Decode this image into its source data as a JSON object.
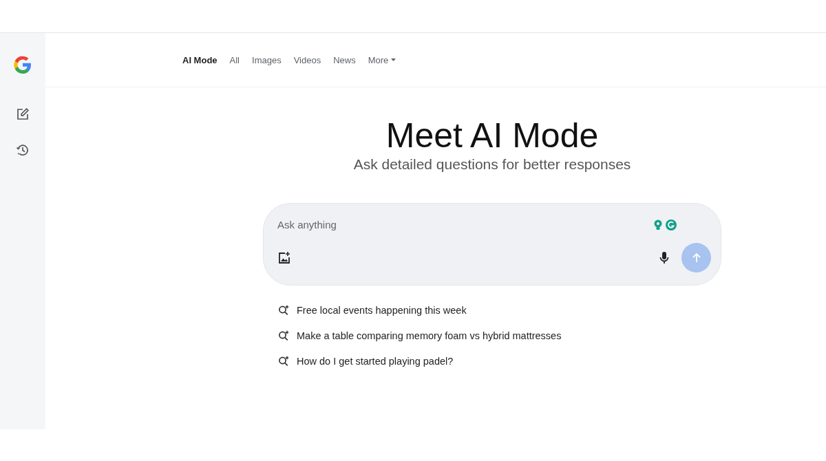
{
  "tabs": [
    {
      "label": "AI Mode",
      "selected": true,
      "has_menu": false
    },
    {
      "label": "All",
      "selected": false,
      "has_menu": false
    },
    {
      "label": "Images",
      "selected": false,
      "has_menu": false
    },
    {
      "label": "Videos",
      "selected": false,
      "has_menu": false
    },
    {
      "label": "News",
      "selected": false,
      "has_menu": false
    },
    {
      "label": "More",
      "selected": false,
      "has_menu": true
    }
  ],
  "hero": {
    "title": "Meet AI Mode",
    "subtitle": "Ask detailed questions for better responses"
  },
  "search": {
    "placeholder": "Ask anything",
    "send_disabled": true
  },
  "suggestions": [
    "Free local events happening this week",
    "Make a table comparing memory foam vs hybrid mattresses",
    "How do I get started playing padel?"
  ]
}
